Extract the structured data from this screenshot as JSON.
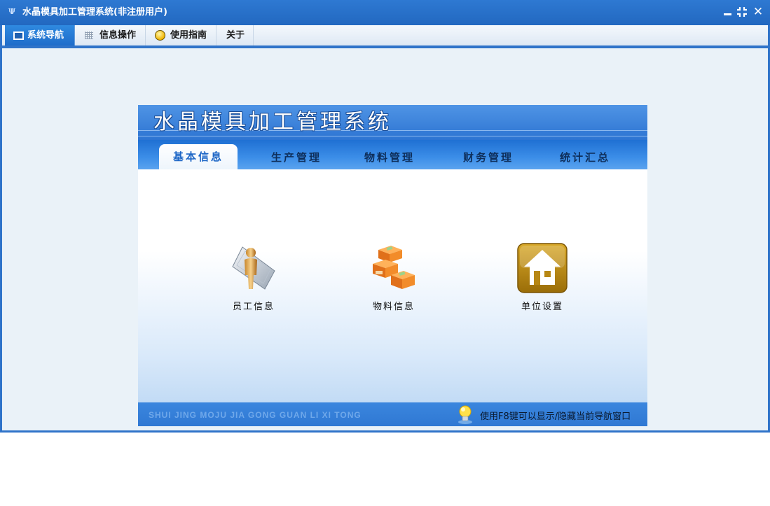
{
  "window": {
    "title": "水晶模具加工管理系统(非注册用户)",
    "icon": "app-logo-icon",
    "controls": [
      "minimize-icon",
      "restore-icon",
      "close-icon"
    ]
  },
  "menu": {
    "items": [
      {
        "label": "系统导航",
        "icon": "monitor-icon",
        "active": true
      },
      {
        "label": "信息操作",
        "icon": "grid-icon",
        "active": false
      },
      {
        "label": "使用指南",
        "icon": "help-icon",
        "active": false
      },
      {
        "label": "关于",
        "icon": "",
        "active": false
      }
    ]
  },
  "panel": {
    "title": "水晶模具加工管理系统",
    "tabs": [
      {
        "label": "基本信息",
        "active": true
      },
      {
        "label": "生产管理",
        "active": false
      },
      {
        "label": "物料管理",
        "active": false
      },
      {
        "label": "财务管理",
        "active": false
      },
      {
        "label": "统计汇总",
        "active": false
      }
    ],
    "tiles": [
      {
        "label": "员工信息",
        "icon": "employee-icon"
      },
      {
        "label": "物料信息",
        "icon": "boxes-icon"
      },
      {
        "label": "单位设置",
        "icon": "house-icon"
      }
    ],
    "footer": {
      "pinyin": "SHUI JING MOJU JIA GONG GUAN LI XI TONG",
      "hint": "使用F8键可以显示/隐藏当前导航窗口",
      "hint_icon": "lightbulb-icon"
    }
  },
  "colors": {
    "title_bar": "#2a70c8",
    "accent": "#2f73c9",
    "tab_active_text": "#1d66c6"
  }
}
